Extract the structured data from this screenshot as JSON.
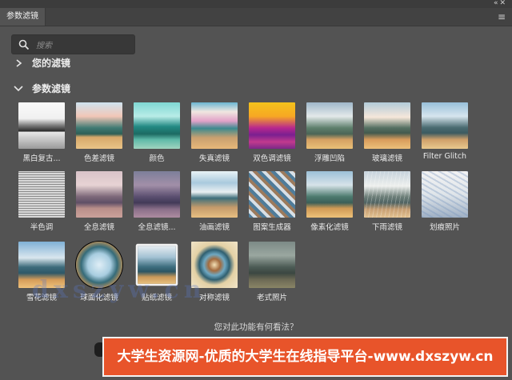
{
  "tab": {
    "title": "参数滤镜"
  },
  "search": {
    "placeholder": "搜索"
  },
  "sections": {
    "mine": "您的滤镜",
    "param": "参数滤镜"
  },
  "filters": [
    {
      "label": "黑白复古...",
      "style": "bw"
    },
    {
      "label": "色差滤镜",
      "style": "chroma"
    },
    {
      "label": "颜色",
      "style": "color"
    },
    {
      "label": "失真滤镜",
      "style": "distort"
    },
    {
      "label": "双色调滤镜",
      "style": "duotone"
    },
    {
      "label": "浮雕凹陷",
      "style": "emboss"
    },
    {
      "label": "玻璃滤镜",
      "style": "glass"
    },
    {
      "label": "Filter Glitch",
      "style": "glitch"
    },
    {
      "label": "半色调",
      "style": "halftone"
    },
    {
      "label": "全息滤镜",
      "style": "holo1"
    },
    {
      "label": "全息滤镜...",
      "style": "holo2"
    },
    {
      "label": "油画滤镜",
      "style": "oil"
    },
    {
      "label": "图案生成器",
      "style": "pattern"
    },
    {
      "label": "像素化滤镜",
      "style": "pixel"
    },
    {
      "label": "下雨滤镜",
      "style": "rain"
    },
    {
      "label": "划痕照片",
      "style": "scratch"
    },
    {
      "label": "雪花滤镜",
      "style": "snow"
    },
    {
      "label": "球面化滤镜",
      "style": "sphere"
    },
    {
      "label": "贴纸滤镜",
      "style": "sticker"
    },
    {
      "label": "对称滤镜",
      "style": "symmetry"
    },
    {
      "label": "老式照片",
      "style": "vintage"
    }
  ],
  "feedback": "您对此功能有何看法？",
  "watermark": "dxszyw.cn",
  "banner": "大学生资源网-优质的大学生在线指导平台-www.dxszyw.cn"
}
